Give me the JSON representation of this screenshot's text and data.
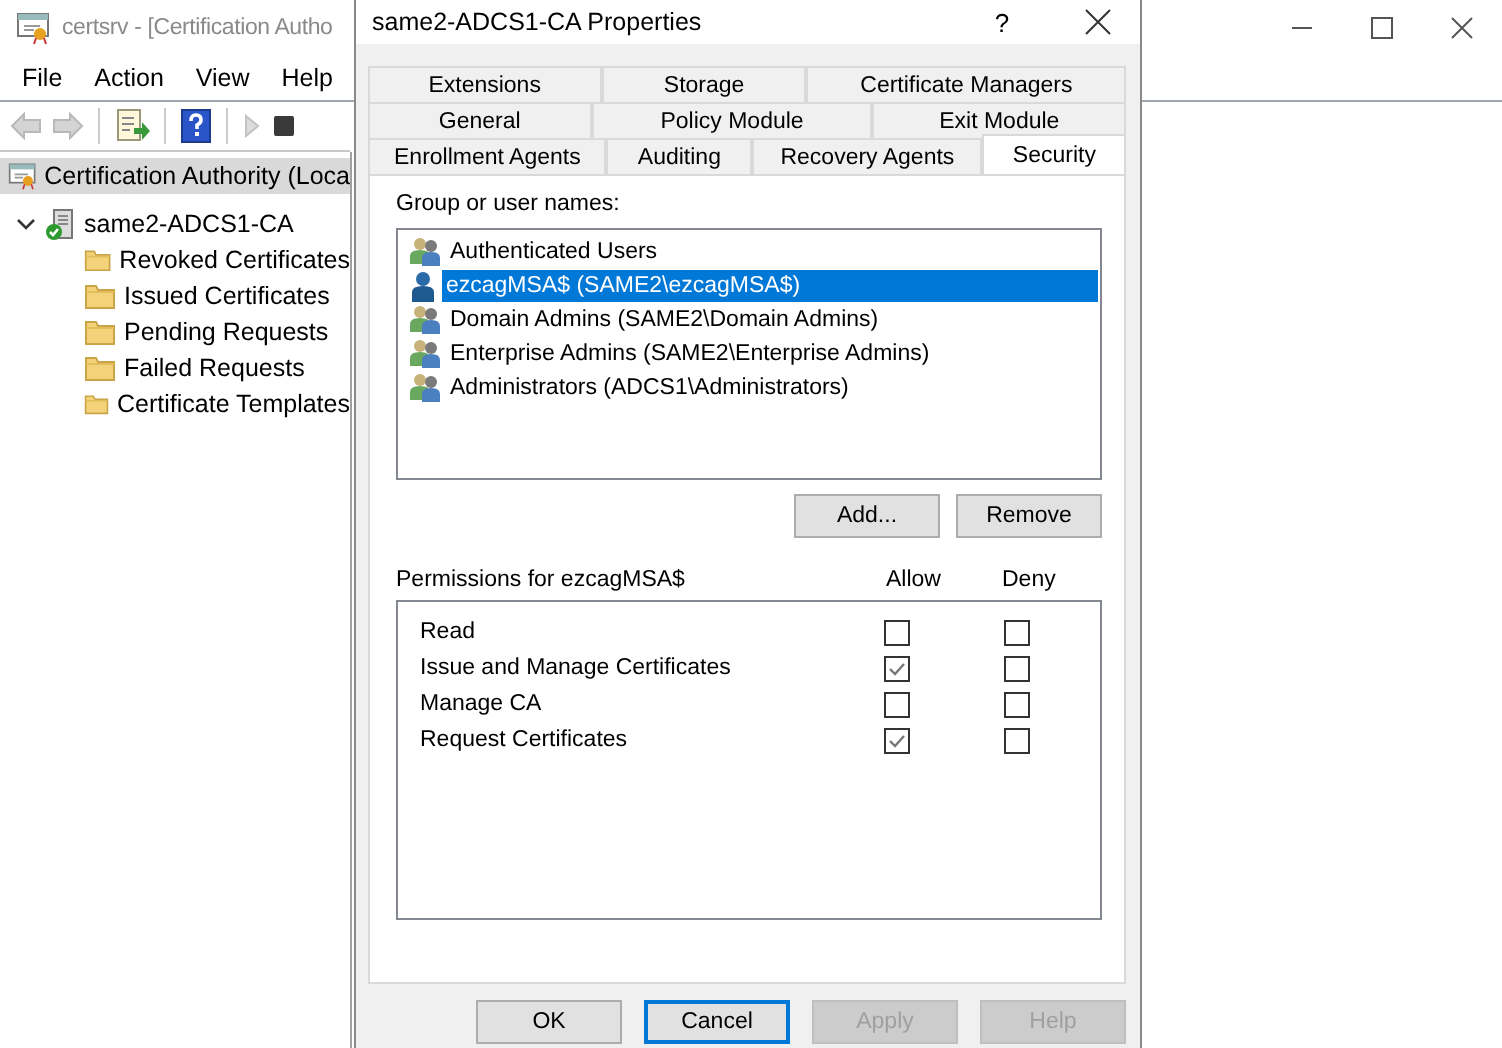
{
  "main_window": {
    "title": "certsrv - [Certification Autho",
    "menu": [
      "File",
      "Action",
      "View",
      "Help"
    ],
    "toolbar": [
      {
        "kind": "back",
        "disabled": true
      },
      {
        "kind": "forward",
        "disabled": true
      },
      {
        "kind": "export",
        "disabled": false
      },
      {
        "kind": "help",
        "disabled": false
      },
      {
        "kind": "play",
        "disabled": true
      },
      {
        "kind": "stop",
        "disabled": false
      }
    ],
    "tree": {
      "label": "Certification Authority (Loca",
      "selected": true,
      "children": [
        {
          "label": "same2-ADCS1-CA",
          "selected": false,
          "expanded": true,
          "children": [
            {
              "label": "Revoked Certificates",
              "selected": false
            },
            {
              "label": "Issued Certificates",
              "selected": false
            },
            {
              "label": "Pending Requests",
              "selected": false
            },
            {
              "label": "Failed Requests",
              "selected": false
            },
            {
              "label": "Certificate Templates",
              "selected": false
            }
          ]
        }
      ]
    }
  },
  "dialog": {
    "title": "same2-ADCS1-CA Properties",
    "help_glyph": "?",
    "tab_rows": [
      [
        {
          "label": "Extensions",
          "selected": false
        },
        {
          "label": "Storage",
          "selected": false
        },
        {
          "label": "Certificate Managers",
          "selected": false
        }
      ],
      [
        {
          "label": "General",
          "selected": false
        },
        {
          "label": "Policy Module",
          "selected": false
        },
        {
          "label": "Exit Module",
          "selected": false
        }
      ],
      [
        {
          "label": "Enrollment Agents",
          "selected": false
        },
        {
          "label": "Auditing",
          "selected": false
        },
        {
          "label": "Recovery Agents",
          "selected": false
        },
        {
          "label": "Security",
          "selected": true
        }
      ]
    ],
    "group_label": "Group or user names:",
    "principals": [
      {
        "kind": "group",
        "name": "Authenticated Users",
        "selected": false
      },
      {
        "kind": "user",
        "name": "ezcagMSA$ (SAME2\\ezcagMSA$)",
        "selected": true
      },
      {
        "kind": "group",
        "name": "Domain Admins (SAME2\\Domain Admins)",
        "selected": false
      },
      {
        "kind": "group",
        "name": "Enterprise Admins (SAME2\\Enterprise Admins)",
        "selected": false
      },
      {
        "kind": "group",
        "name": "Administrators (ADCS1\\Administrators)",
        "selected": false
      }
    ],
    "list_buttons": [
      "Add...",
      "Remove"
    ],
    "permissions_label": "Permissions for ezcagMSA$",
    "allow_header": "Allow",
    "deny_header": "Deny",
    "permissions": [
      {
        "name": "Read",
        "allow": false,
        "deny": false
      },
      {
        "name": "Issue and Manage Certificates",
        "allow": true,
        "deny": false
      },
      {
        "name": "Manage CA",
        "allow": false,
        "deny": false
      },
      {
        "name": "Request Certificates",
        "allow": true,
        "deny": false
      }
    ],
    "buttons": [
      {
        "label": "OK",
        "disabled": false,
        "focused": false
      },
      {
        "label": "Cancel",
        "disabled": false,
        "focused": true
      },
      {
        "label": "Apply",
        "disabled": true,
        "focused": false
      },
      {
        "label": "Help",
        "disabled": true,
        "focused": false
      }
    ]
  }
}
